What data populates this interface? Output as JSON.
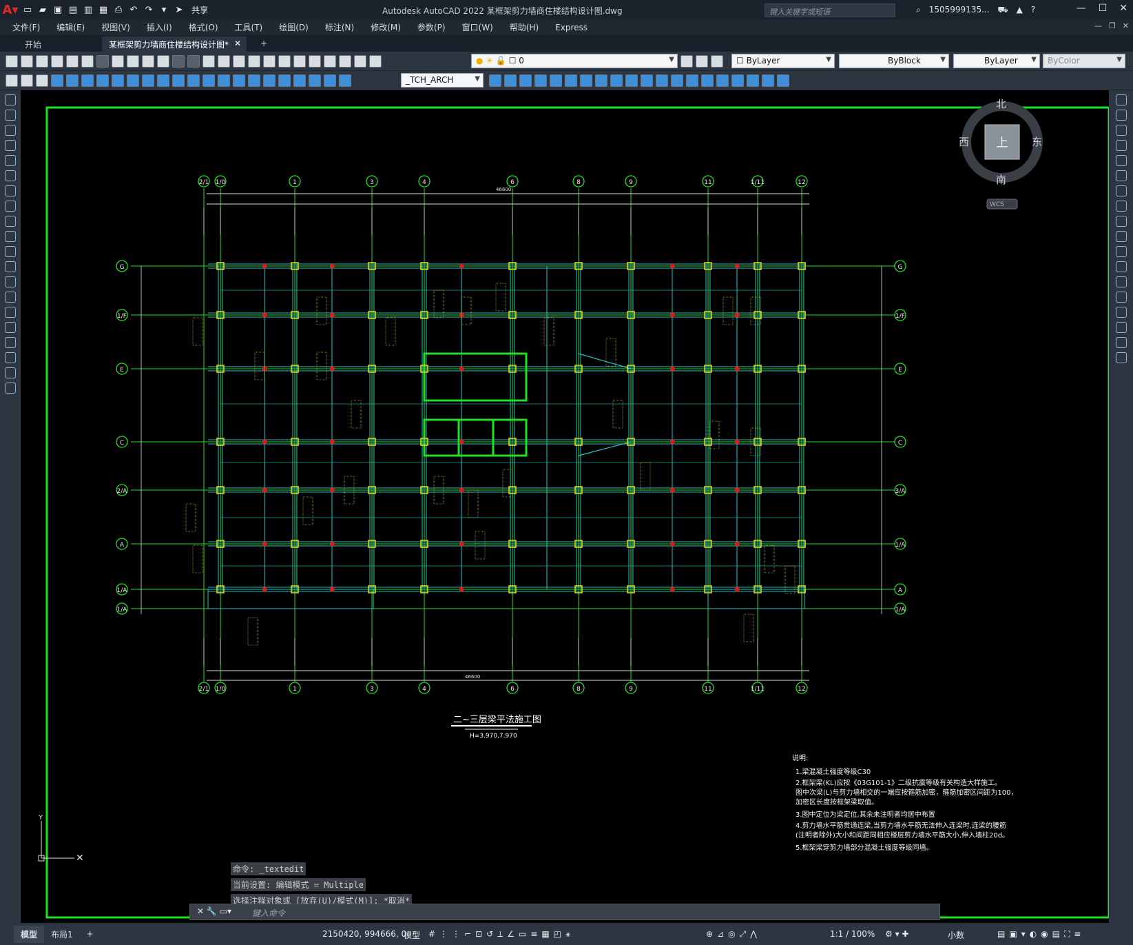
{
  "app": {
    "title": "Autodesk AutoCAD 2022    某框架剪力墙商住楼结构设计图.dwg",
    "share_label": "共享",
    "search_placeholder": "键入关键字或短语",
    "user": "1505999135...",
    "menus": [
      "文件(F)",
      "编辑(E)",
      "视图(V)",
      "插入(I)",
      "格式(O)",
      "工具(T)",
      "绘图(D)",
      "标注(N)",
      "修改(M)",
      "参数(P)",
      "窗口(W)",
      "帮助(H)",
      "Express"
    ],
    "tabs": [
      "开始",
      "某框架剪力墙商住楼结构设计图*"
    ],
    "tab_add": "+"
  },
  "toolbar": {
    "layer_value": "0",
    "color_value": "ByLayer",
    "linetype_value": "ByBlock",
    "lineweight_value": "ByLayer",
    "plotstyle_value": "ByColor",
    "textstyle_value": "_TCH_ARCH"
  },
  "viewcube": {
    "north": "北",
    "south": "南",
    "east": "东",
    "west": "西",
    "face": "上",
    "wcs": "WCS"
  },
  "drawing": {
    "title": "二~三层梁平法施工图",
    "subtitle": "H=3.970,7.970",
    "top_axes": [
      "2/1",
      "1/0",
      "1",
      "3",
      "4",
      "6",
      "8",
      "9",
      "11",
      "1/11",
      "12"
    ],
    "left_axes": [
      "G",
      "1/F",
      "E",
      "C",
      "2/A",
      "A",
      "1/A",
      "1/A"
    ],
    "right_axes": [
      "G",
      "1/F",
      "E",
      "C",
      "3/A",
      "1/A",
      "A",
      "1/A",
      "1/A"
    ],
    "overall_dim": "46600",
    "notes_title": "说明:",
    "notes": [
      "1.梁混凝土强度等级C30",
      "2.框架梁(KL)应按《03G101-1》二级抗震等级有关构造大样施工。",
      "  图中次梁(L)与剪力墙相交的一端应按箍筋加密，箍筋加密区间距为100，",
      "  加密区长度按框架梁取值。",
      "3.图中定位为梁定位,其余未注明者均居中布置",
      "4.剪力墙水平筋贯通连梁,当剪力墙水平筋无法伸入连梁时,连梁的腰筋",
      "  (注明者除外)大小和间距同相应楼层剪力墙水平筋大小,伸入墙柱20d。",
      "5.框架梁穿剪力墙部分混凝土强度等级同墙。"
    ]
  },
  "command": {
    "history": [
      "命令: _textedit",
      "当前设置: 编辑模式 = Multiple",
      "选择注释对象或 [放弃(U)/模式(M)]: *取消*"
    ],
    "placeholder": "键入命令"
  },
  "status": {
    "layout_tabs": [
      "模型",
      "布局1"
    ],
    "add": "+",
    "coords": "2150420, 994666, 0",
    "mode": "模型",
    "scale": "1:1 / 100%",
    "units": "小数"
  }
}
